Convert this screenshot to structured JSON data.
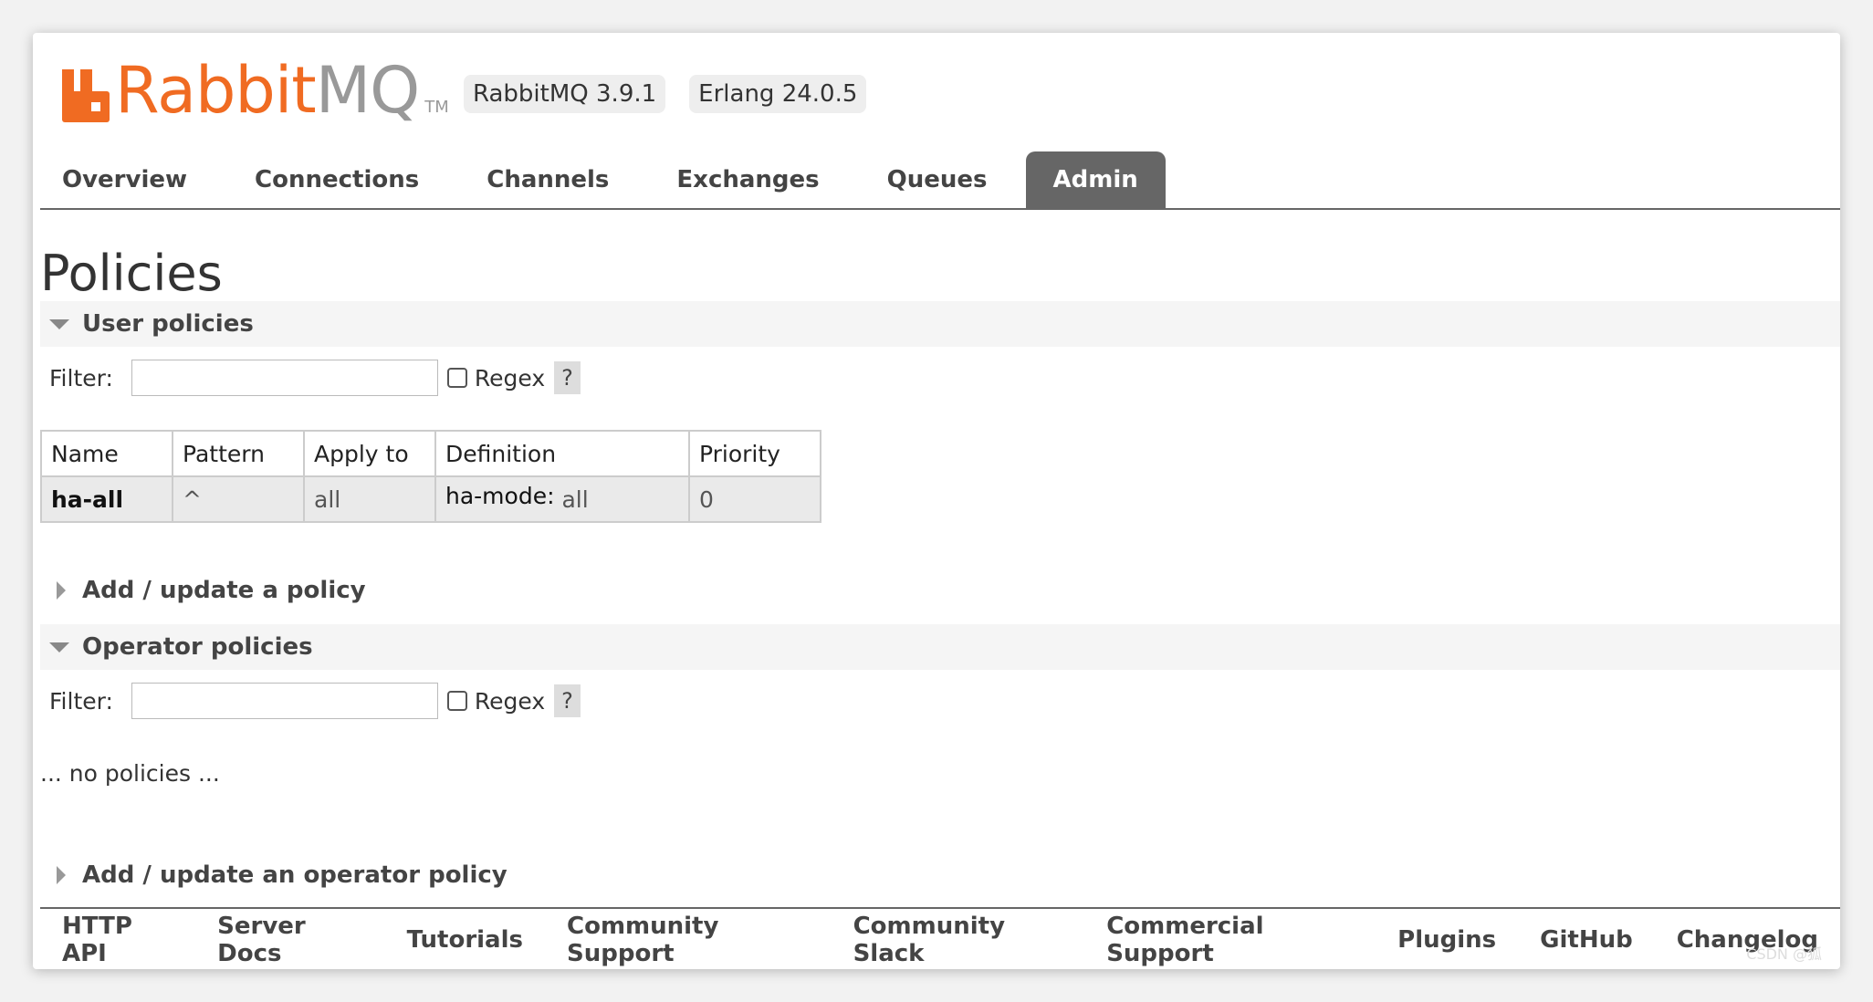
{
  "header": {
    "logo_rabbit": "Rabbit",
    "logo_mq": "MQ",
    "logo_tm": "TM",
    "version": "RabbitMQ 3.9.1",
    "erlang": "Erlang 24.0.5",
    "brand_color": "#f06b22"
  },
  "nav": {
    "tabs": [
      {
        "label": "Overview"
      },
      {
        "label": "Connections"
      },
      {
        "label": "Channels"
      },
      {
        "label": "Exchanges"
      },
      {
        "label": "Queues"
      },
      {
        "label": "Admin",
        "active": true
      }
    ]
  },
  "page": {
    "title": "Policies"
  },
  "user_policies": {
    "header": "User policies",
    "filter_label": "Filter:",
    "filter_value": "",
    "regex_label": "Regex",
    "help": "?",
    "columns": [
      "Name",
      "Pattern",
      "Apply to",
      "Definition",
      "Priority"
    ],
    "rows": [
      {
        "name": "ha-all",
        "pattern": "^",
        "apply_to": "all",
        "definition_key": "ha-mode:",
        "definition_value": "all",
        "priority": "0"
      }
    ],
    "add_update": "Add / update a policy"
  },
  "operator_policies": {
    "header": "Operator policies",
    "filter_label": "Filter:",
    "filter_value": "",
    "regex_label": "Regex",
    "help": "?",
    "empty_text": "... no policies ...",
    "add_update": "Add / update an operator policy"
  },
  "footer": {
    "links": [
      {
        "label": "HTTP API"
      },
      {
        "label": "Server Docs"
      },
      {
        "label": "Tutorials"
      },
      {
        "label": "Community Support"
      },
      {
        "label": "Community Slack"
      },
      {
        "label": "Commercial Support"
      },
      {
        "label": "Plugins"
      },
      {
        "label": "GitHub"
      },
      {
        "label": "Changelog"
      }
    ]
  },
  "watermark": "CSDN @狐"
}
